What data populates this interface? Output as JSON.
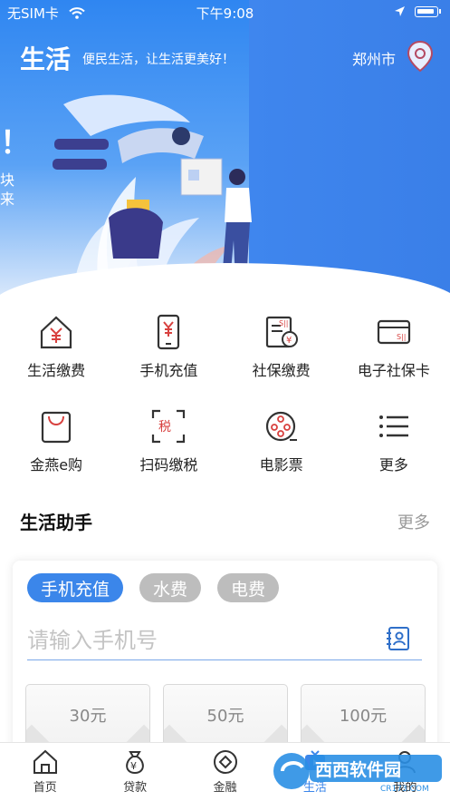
{
  "status": {
    "carrier": "无SIM卡",
    "time": "下午9:08"
  },
  "header": {
    "title": "生活",
    "slogan": "便民生活，让生活更美好！",
    "city": "郑州市"
  },
  "hero_fragments": {
    "exclaim": "！",
    "line1": "块",
    "line2": "来"
  },
  "services": [
    [
      {
        "label": "生活缴费",
        "icon": "house-yen-icon"
      },
      {
        "label": "手机充值",
        "icon": "phone-yen-icon"
      },
      {
        "label": "社保缴费",
        "icon": "social-security-icon"
      },
      {
        "label": "电子社保卡",
        "icon": "card-icon"
      }
    ],
    [
      {
        "label": "金燕e购",
        "icon": "shopping-bag-icon"
      },
      {
        "label": "扫码缴税",
        "icon": "scan-tax-icon"
      },
      {
        "label": "电影票",
        "icon": "film-reel-icon"
      },
      {
        "label": "更多",
        "icon": "list-icon"
      }
    ]
  ],
  "assistant": {
    "title": "生活助手",
    "more": "更多",
    "tabs": [
      "手机充值",
      "水费",
      "电费"
    ],
    "active_tab": 0,
    "phone_placeholder": "请输入手机号",
    "amounts": [
      "30元",
      "50元",
      "100元"
    ]
  },
  "tabbar": {
    "items": [
      {
        "label": "首页",
        "icon": "home-icon"
      },
      {
        "label": "贷款",
        "icon": "money-bag-icon"
      },
      {
        "label": "金融",
        "icon": "finance-icon"
      },
      {
        "label": "生活",
        "icon": "life-icon"
      },
      {
        "label": "我的",
        "icon": "user-icon"
      }
    ],
    "active": 3
  },
  "watermark": {
    "text": "西西软件园",
    "url": "CR173.COM"
  },
  "colors": {
    "accent": "#3b86ea",
    "hero": "#3a82ec"
  }
}
